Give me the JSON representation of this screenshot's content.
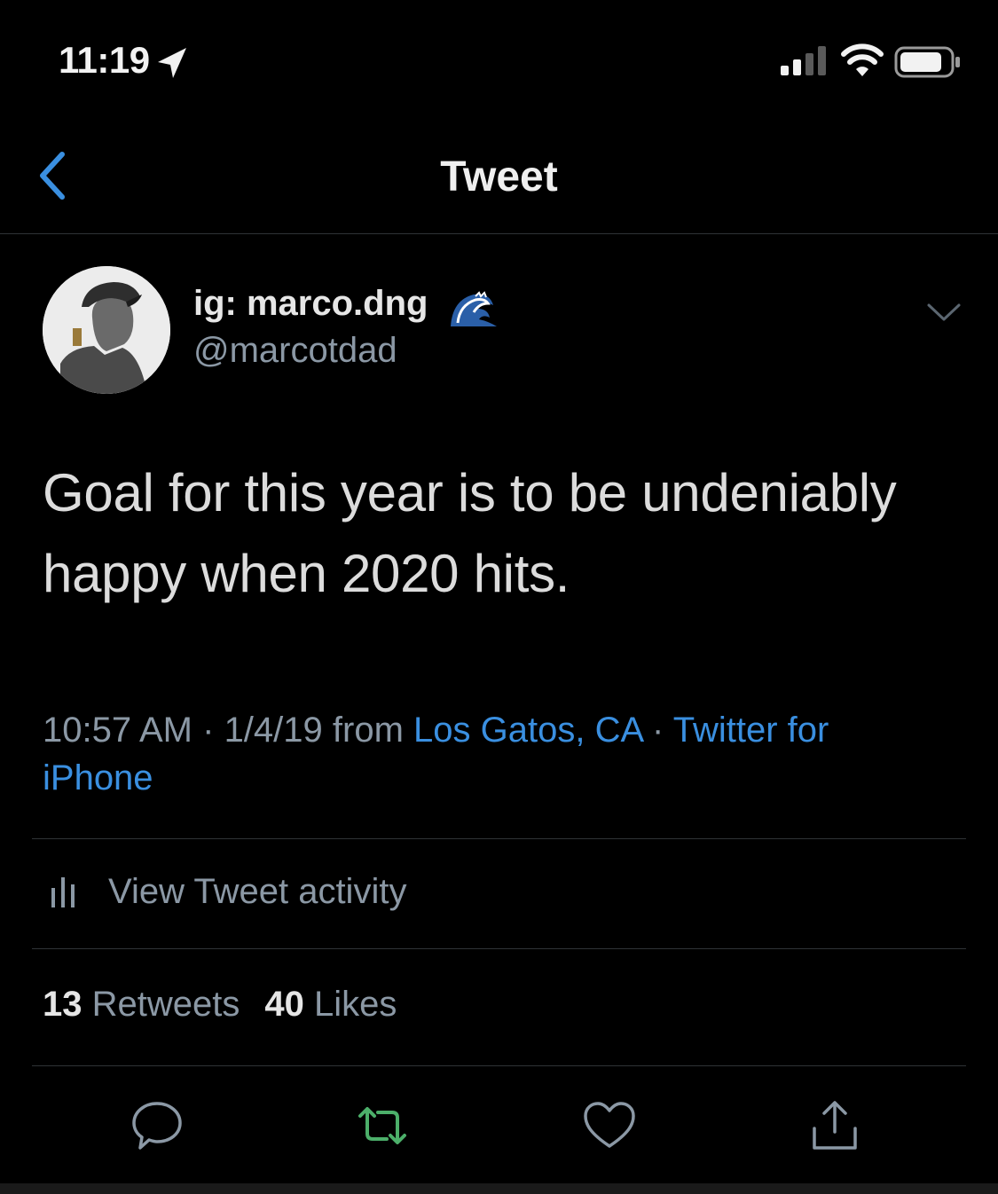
{
  "status_bar": {
    "time": "11:19",
    "icons": [
      "location-arrow-icon",
      "cellular-signal-icon",
      "wifi-icon",
      "battery-icon"
    ]
  },
  "nav": {
    "title": "Tweet",
    "back_icon": "chevron-left-icon"
  },
  "tweet": {
    "author": {
      "display_name": "ig: marco.dng",
      "emoji_icon": "wave-emoji-icon",
      "handle": "@marcotdad"
    },
    "text_line1": "Goal for this year is to be undeniably",
    "text_line2": "happy when 2020 hits.",
    "meta": {
      "time": "10:57 AM",
      "sep1": " · ",
      "date": "1/4/19",
      "from": " from ",
      "location": "Los Gatos, CA",
      "sep2": " · ",
      "source_line1": "Twitter for",
      "source_line2": "iPhone"
    },
    "activity_label": "View Tweet activity",
    "counts": {
      "retweets_count": "13",
      "retweets_label": "Retweets",
      "likes_count": "40",
      "likes_label": "Likes"
    }
  },
  "actions": [
    "reply-icon",
    "retweet-icon",
    "like-icon",
    "share-icon"
  ],
  "colors": {
    "background": "#000000",
    "link_blue": "#3a8fe0",
    "retweet_green": "#4caf6a",
    "muted_text": "#8b98a5",
    "divider": "#2f3336"
  }
}
